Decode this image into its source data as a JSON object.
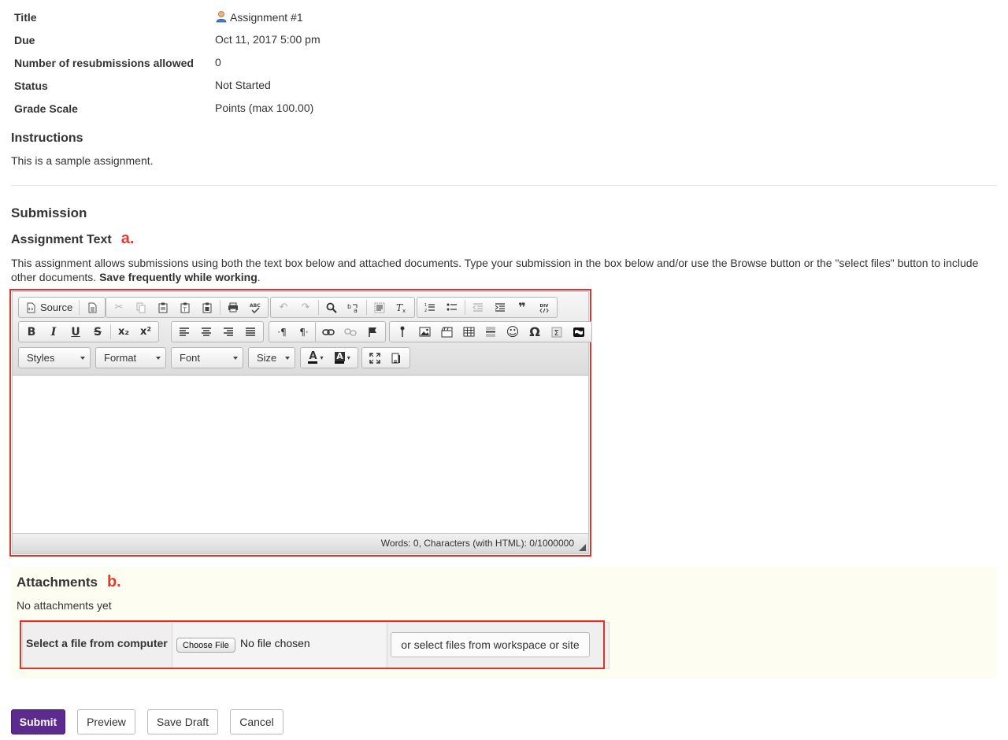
{
  "details": [
    {
      "label": "Title",
      "value": "Assignment #1"
    },
    {
      "label": "Due",
      "value": "Oct 11, 2017 5:00 pm"
    },
    {
      "label": "Number of resubmissions allowed",
      "value": "0"
    },
    {
      "label": "Status",
      "value": "Not Started"
    },
    {
      "label": "Grade Scale",
      "value": "Points (max 100.00)"
    }
  ],
  "instructions": {
    "heading": "Instructions",
    "text": "This is a sample assignment."
  },
  "submission": {
    "heading": "Submission",
    "assignment_text_heading": "Assignment Text",
    "marker_a": "a.",
    "description": "This assignment allows submissions using both the text box below and attached documents. Type your submission in the box below and/or use the Browse button or the \"select files\" button to include other documents.",
    "description_bold": "Save frequently while working",
    "description_end": "."
  },
  "editor": {
    "source_label": "Source",
    "styles_label": "Styles",
    "format_label": "Format",
    "font_label": "Font",
    "size_label": "Size",
    "status": "Words: 0, Characters (with HTML): 0/1000000",
    "glyphs": {
      "bold": "B",
      "italic": "I",
      "underline": "U",
      "strike": "S",
      "subscript": "x₂",
      "superscript": "x²",
      "pilcrow_ltr": "·¶",
      "pilcrow_rtl": "¶·",
      "omega": "Ω",
      "sigma": "Σ",
      "quote": "❞",
      "text_color": "A",
      "bg_color": "A"
    }
  },
  "attachments": {
    "heading": "Attachments",
    "marker_b": "b.",
    "empty_text": "No attachments yet",
    "select_label": "Select a file from computer",
    "choose_button": "Choose File",
    "no_file": "No file chosen",
    "workspace_button": "or select files from workspace or site"
  },
  "actions": {
    "submit": "Submit",
    "preview": "Preview",
    "save_draft": "Save Draft",
    "cancel": "Cancel"
  },
  "colors": {
    "accent": "#5d2a8e",
    "annotation_red": "#e53a2c"
  }
}
